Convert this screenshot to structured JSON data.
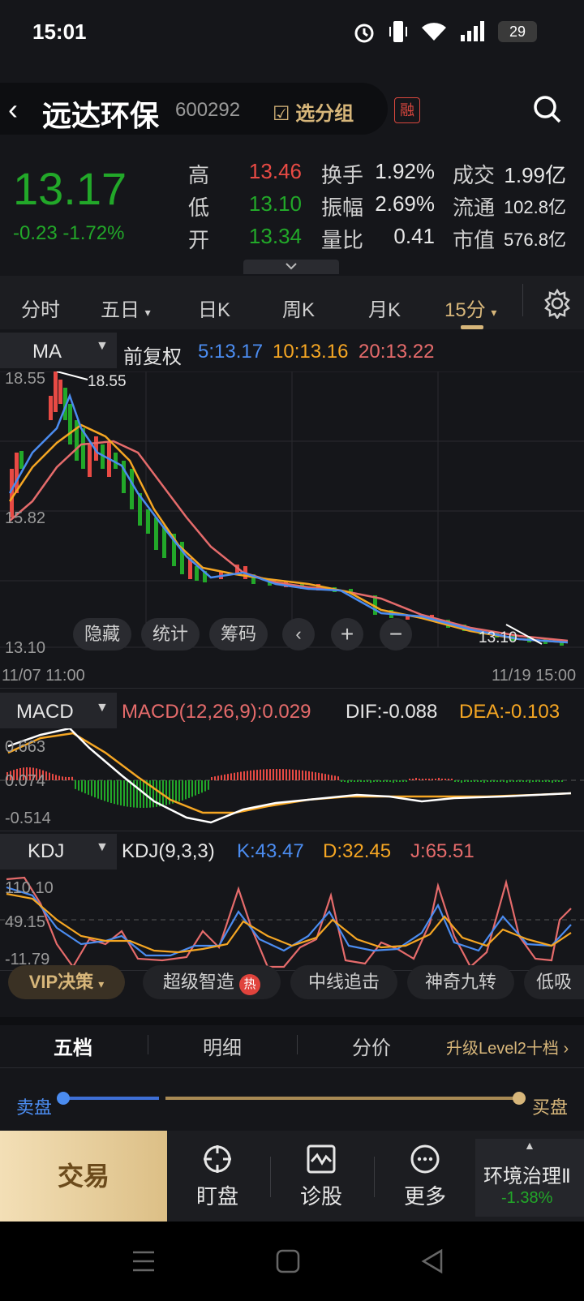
{
  "status": {
    "time": "15:01",
    "battery": "29"
  },
  "header": {
    "name": "远达环保",
    "code": "600292",
    "group_btn": "选分组",
    "badge": "融"
  },
  "quote": {
    "price": "13.17",
    "change": "-0.23 -1.72%",
    "high_label": "高",
    "high": "13.46",
    "low_label": "低",
    "low": "13.10",
    "open_label": "开",
    "open": "13.34",
    "turnover_label": "换手",
    "turnover": "1.92%",
    "amplitude_label": "振幅",
    "amplitude": "2.69%",
    "vol_ratio_label": "量比",
    "vol_ratio": "0.41",
    "deal_label": "成交",
    "deal": "1.99亿",
    "float_label": "流通",
    "float": "102.8亿",
    "mcap_label": "市值",
    "mcap": "576.8亿"
  },
  "tabs": [
    "分时",
    "五日",
    "日K",
    "周K",
    "月K",
    "15分"
  ],
  "ma": {
    "label": "MA",
    "fq": "前复权",
    "ma5": "5:13.17",
    "ma10": "10:13.16",
    "ma20": "20:13.22"
  },
  "chart": {
    "top_price": "18.55",
    "peak_label": "18.55",
    "mid_price": "15.82",
    "low_price": "13.10",
    "low_marker": "13.10",
    "start_time": "11/07 11:00",
    "end_time": "11/19 15:00",
    "buttons": [
      "隐藏",
      "统计",
      "筹码"
    ]
  },
  "macd": {
    "label": "MACD",
    "params": "MACD(12,26,9):0.029",
    "dif": "DIF:-0.088",
    "dea": "DEA:-0.103",
    "top": "0.663",
    "mid": "0.074",
    "bottom": "-0.514"
  },
  "kdj": {
    "label": "KDJ",
    "params": "KDJ(9,3,3)",
    "k": "K:43.47",
    "d": "D:32.45",
    "j": "J:65.51",
    "top": "110.10",
    "mid": "49.15",
    "bottom": "-11.79"
  },
  "tags": {
    "vip": "VIP决策",
    "items": [
      "超级智造",
      "中线追击",
      "神奇九转",
      "低吸"
    ],
    "hot": "热"
  },
  "orders": {
    "tabs": [
      "五档",
      "明细",
      "分价"
    ],
    "upgrade": "升级Level2十档",
    "sell": "卖盘",
    "buy": "买盘"
  },
  "bottom": {
    "trade": "交易",
    "watch": "盯盘",
    "diagnose": "诊股",
    "more": "更多",
    "sector": "环境治理Ⅱ",
    "sector_change": "-1.38%"
  }
}
